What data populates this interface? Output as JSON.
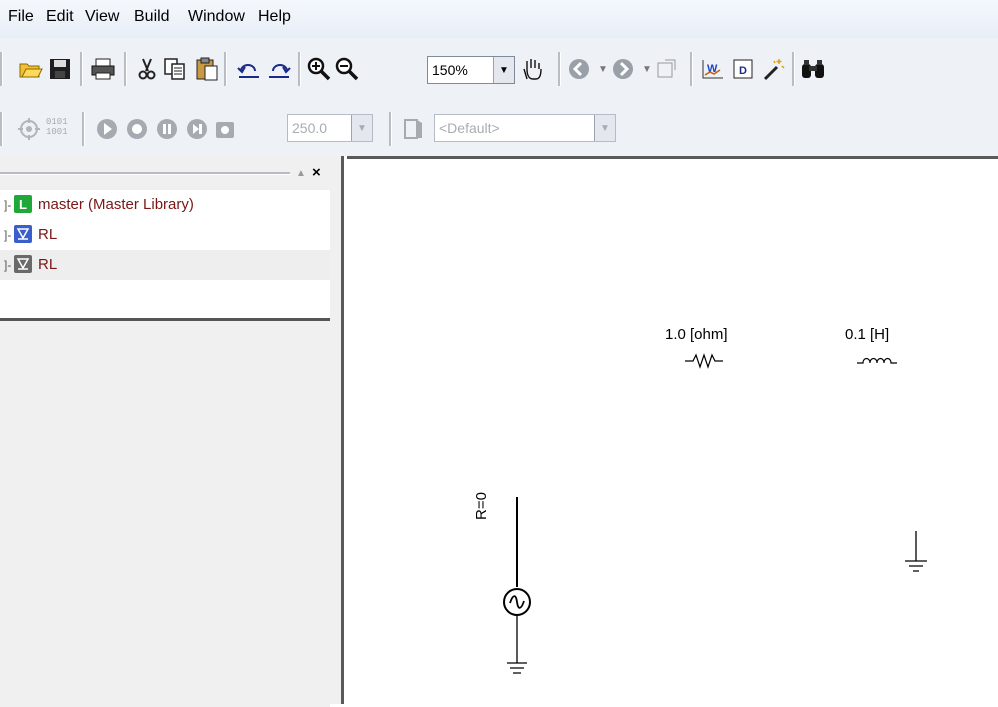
{
  "menubar": {
    "items": [
      "File",
      "Edit",
      "View",
      "Build",
      "Window",
      "Help"
    ]
  },
  "toolbar_main": {
    "zoom_value": "150%",
    "icons": [
      "open-folder-icon",
      "save-icon",
      "print-icon",
      "cut-icon",
      "copy-icon",
      "paste-icon",
      "undo-icon",
      "redo-icon",
      "zoom-in-icon",
      "zoom-out-icon",
      "pan-hand-icon",
      "back-icon",
      "forward-icon",
      "new-window-icon",
      "chart-icon",
      "d-icon",
      "wand-icon",
      "binoculars-icon"
    ]
  },
  "toolbar_build": {
    "time_value": "250.0",
    "profile_value": "<Default>",
    "binary_label_top": "0101",
    "binary_label_bottom": "1001"
  },
  "workspace": {
    "tree": [
      {
        "label": "master (Master Library)",
        "icon": "library-icon",
        "icon_text": "L"
      },
      {
        "label": "RL",
        "icon": "project-icon"
      },
      {
        "label": "RL",
        "icon": "project-icon"
      }
    ]
  },
  "canvas": {
    "resistor_label": "1.0 [ohm]",
    "inductor_label": "0.1 [H]",
    "source_label": "R=0"
  },
  "colors": {
    "library_icon": "#1fa83a",
    "project_icon": "#3a5fcd",
    "tree_label": "#7a1616"
  }
}
